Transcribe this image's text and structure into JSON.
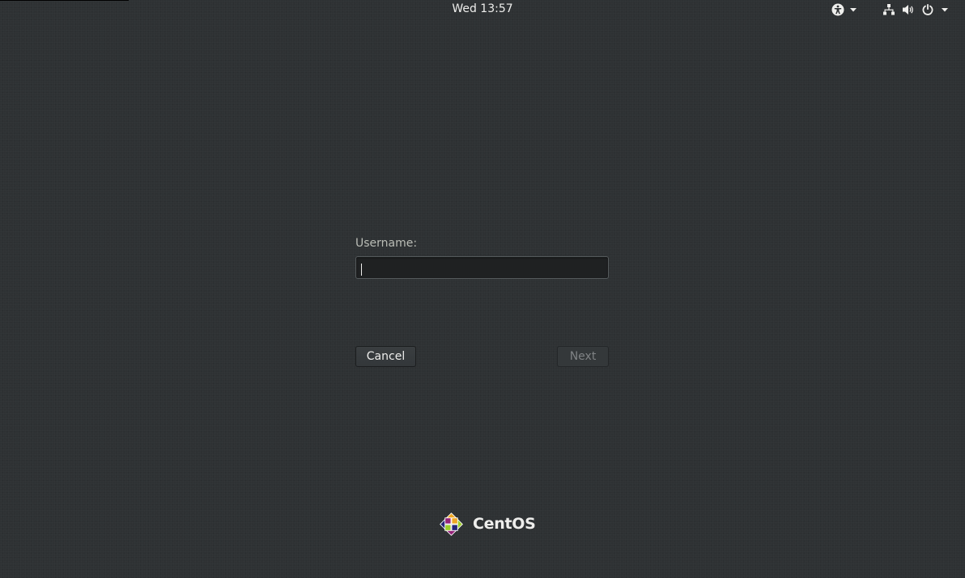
{
  "topbar": {
    "clock": "Wed 13:57",
    "icons": {
      "accessibility": "accessibility-icon",
      "network": "network-wired-icon",
      "volume": "volume-icon",
      "power": "power-icon",
      "menu_caret": "chevron-down-icon"
    }
  },
  "login": {
    "username_label": "Username:",
    "username_value": "",
    "cancel_label": "Cancel",
    "next_label": "Next"
  },
  "brand": {
    "name": "CentOS",
    "logo_colors": [
      "#efa724",
      "#9ccd2a",
      "#932279",
      "#262577"
    ]
  }
}
